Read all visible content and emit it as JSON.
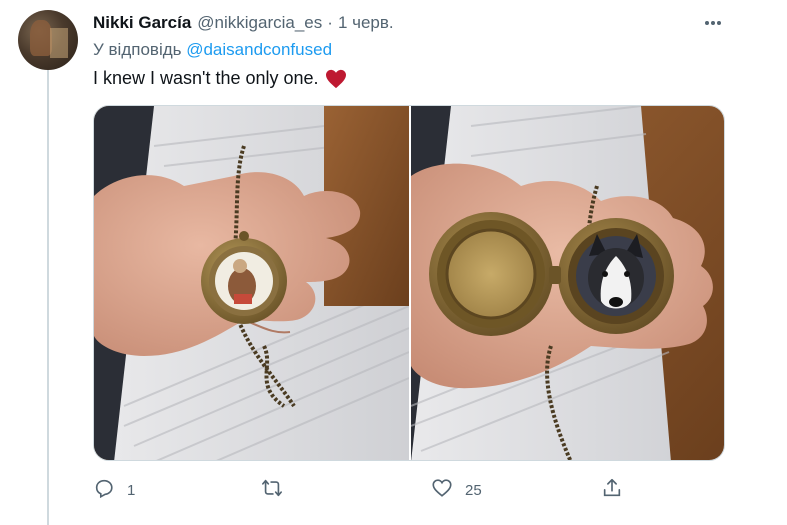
{
  "tweet": {
    "author_name": "Nikki García",
    "author_handle": "@nikkigarcia_es",
    "separator": "·",
    "timestamp": "1 черв.",
    "reply_prefix": "У відповідь ",
    "reply_to_handle": "@daisandconfused",
    "text": "I knew I wasn't the only one.",
    "emoji": "heart-emoji"
  },
  "media": {
    "photos": [
      {
        "icon": "photo-locket-closed"
      },
      {
        "icon": "photo-locket-open-husky"
      }
    ]
  },
  "actions": {
    "reply": {
      "icon": "reply-icon",
      "count": "1"
    },
    "retweet": {
      "icon": "retweet-icon",
      "count": ""
    },
    "like": {
      "icon": "like-icon",
      "count": "25"
    },
    "share": {
      "icon": "share-icon",
      "count": ""
    }
  },
  "colors": {
    "link": "#1d9bf0",
    "secondary_text": "#536471",
    "heart": "#e0245e"
  }
}
